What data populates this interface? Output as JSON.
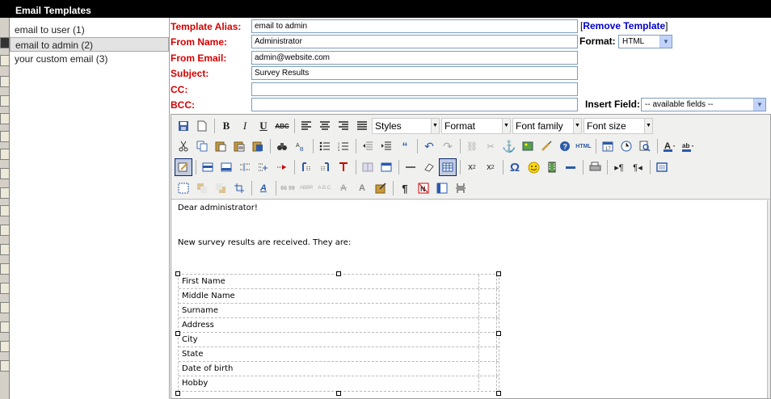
{
  "panel": {
    "title": "Email Templates"
  },
  "templates": [
    {
      "label": "email to user (1)",
      "selected": false
    },
    {
      "label": "email to admin (2)",
      "selected": true
    },
    {
      "label": "your custom email (3)",
      "selected": false
    }
  ],
  "form": {
    "alias_label": "Template Alias:",
    "alias_value": "email to admin",
    "from_name_label": "From Name:",
    "from_name_value": "Administrator",
    "from_email_label": "From Email:",
    "from_email_value": "admin@website.com",
    "subject_label": "Subject:",
    "subject_value": "Survey Results",
    "cc_label": "CC:",
    "cc_value": "",
    "bcc_label": "BCC:",
    "bcc_value": "",
    "remove_template": "Remove Template",
    "format_label": "Format:",
    "format_value": "HTML",
    "insert_field_label": "Insert Field:",
    "insert_field_value": "-- available fields --"
  },
  "toolbar": {
    "styles": "Styles",
    "format": "Format",
    "font_family": "Font family",
    "font_size": "Font size"
  },
  "content": {
    "greeting": "Dear administrator!",
    "intro": "New survey results are received. They are:",
    "fields": [
      "First Name",
      "Middle Name",
      "Surname",
      "Address",
      "City",
      "State",
      "Date of birth",
      "Hobby"
    ]
  },
  "colors": {
    "label_red": "#d40000",
    "link_blue": "#0000c8",
    "title_bg": "#000000"
  },
  "icons": [
    "save-icon",
    "new-document-icon",
    "bold-icon",
    "italic-icon",
    "underline-icon",
    "strikethrough-icon",
    "align-left-icon",
    "align-center-icon",
    "align-right-icon",
    "justify-icon",
    "cut-icon",
    "copy-icon",
    "paste-icon",
    "find-icon",
    "bullet-list-icon",
    "numbered-list-icon",
    "undo-icon",
    "redo-icon",
    "link-icon",
    "anchor-icon",
    "image-icon",
    "help-icon",
    "html-icon",
    "table-icon",
    "omega-icon",
    "smiley-icon",
    "print-icon"
  ]
}
